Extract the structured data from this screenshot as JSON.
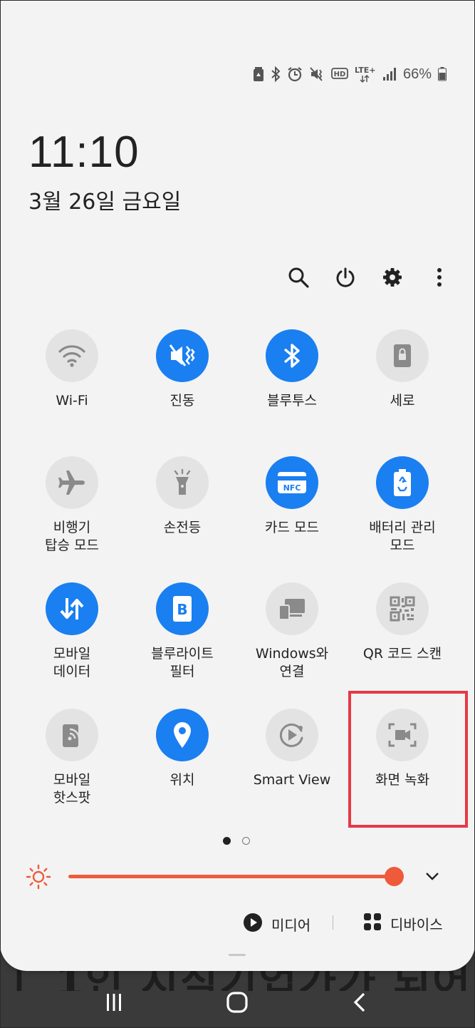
{
  "status_bar": {
    "network": "LTE+",
    "battery_percent": "66%",
    "icons": [
      "battery-saver-icon",
      "bluetooth-icon",
      "alarm-icon",
      "mute-icon",
      "hd-icon",
      "lte-icon",
      "signal-icon",
      "battery-icon"
    ]
  },
  "clock": {
    "time": "11:10",
    "date": "3월 26일 금요일"
  },
  "toolbar": {
    "icons": [
      "search-icon",
      "power-icon",
      "settings-icon",
      "more-icon"
    ]
  },
  "quick_settings": {
    "tiles": [
      {
        "label": "Wi-Fi",
        "state": "off",
        "icon": "wifi-icon"
      },
      {
        "label": "진동",
        "state": "on",
        "icon": "vibrate-icon"
      },
      {
        "label": "블루투스",
        "state": "on",
        "icon": "bluetooth-icon"
      },
      {
        "label": "세로",
        "state": "off",
        "icon": "portrait-lock-icon"
      },
      {
        "label": "비행기\n탑승 모드",
        "state": "off",
        "icon": "airplane-icon"
      },
      {
        "label": "손전등",
        "state": "off",
        "icon": "flashlight-icon"
      },
      {
        "label": "카드 모드",
        "state": "on",
        "icon": "nfc-icon",
        "icon_text": "NFC"
      },
      {
        "label": "배터리 관리\n모드",
        "state": "on",
        "icon": "battery-manage-icon"
      },
      {
        "label": "모바일\n데이터",
        "state": "on",
        "icon": "mobile-data-icon"
      },
      {
        "label": "블루라이트\n필터",
        "state": "on",
        "icon": "blue-light-icon",
        "icon_text": "B"
      },
      {
        "label": "Windows와\n연결",
        "state": "off",
        "icon": "link-windows-icon"
      },
      {
        "label": "QR 코드 스캔",
        "state": "off",
        "icon": "qr-icon"
      },
      {
        "label": "모바일\n핫스팟",
        "state": "off",
        "icon": "hotspot-icon"
      },
      {
        "label": "위치",
        "state": "on",
        "icon": "location-icon"
      },
      {
        "label": "Smart View",
        "state": "off",
        "icon": "smart-view-icon"
      },
      {
        "label": "화면 녹화",
        "state": "off",
        "icon": "screen-record-icon"
      }
    ]
  },
  "pager": {
    "pages": 2,
    "current": 1
  },
  "brightness": {
    "level": 0.98
  },
  "media": {
    "media_label": "미디어",
    "devices_label": "디바이스"
  },
  "colors": {
    "accent": "#1a7ff0",
    "brightness": "#ee5a3a",
    "highlight": "#e63946"
  }
}
